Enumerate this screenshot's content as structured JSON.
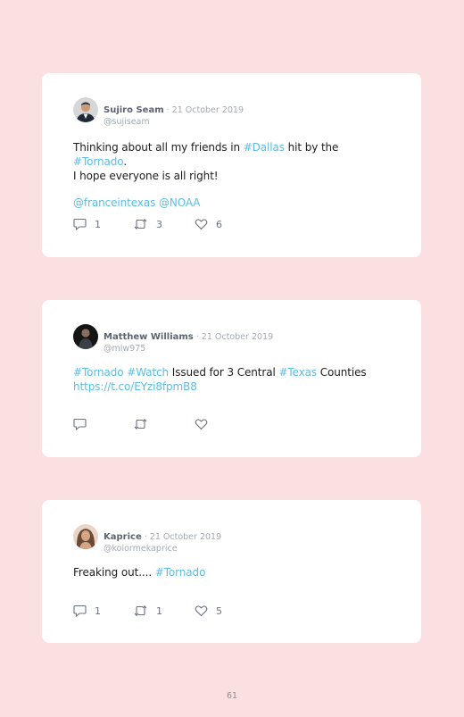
{
  "tweets": [
    {
      "name": "Sujiro Seam",
      "date": " · 21 October 2019",
      "handle": "@sujiseam",
      "line1": [
        "Thinking about all my friends in ",
        "#Dallas",
        " hit by the ",
        "#Tornado",
        "."
      ],
      "line2": "I hope everyone is all right!",
      "mentions": [
        "@franceintexas",
        "@NOAA"
      ],
      "replies": "1",
      "retweets": "3",
      "likes": "6",
      "avatar_colors": {
        "bg": "#d7d7d7",
        "skin": "#c89b7b",
        "suit": "#1f2a38",
        "shirt": "#f2f2f2"
      }
    },
    {
      "name": "Matthew Williams",
      "date": " · 21 October 2019",
      "handle": "@mlw975",
      "line1": [
        "#Tornado",
        " ",
        "#Watch",
        " Issued for 3 Central ",
        "#Texas",
        " Counties"
      ],
      "line2": "https://t.co/EYzi8fpmB8",
      "replies": "",
      "retweets": "",
      "likes": "",
      "avatar_colors": {
        "bg": "#151515",
        "skin": "#8a6f5f",
        "suit": "#3b4048"
      }
    },
    {
      "name": "Kaprice",
      "date": " · 21 October 2019",
      "handle": "@kolormekaprice",
      "line1": [
        "Freaking out.... ",
        "#Tornado"
      ],
      "replies": "1",
      "retweets": "1",
      "likes": "5",
      "avatar_colors": {
        "bg": "#e9d6c8",
        "skin": "#d2a686",
        "hair": "#6b4a33"
      }
    }
  ],
  "page_number": "61",
  "colors": {
    "background": "#fbe0e1",
    "link": "#5bbde5",
    "card": "#ffffff"
  }
}
